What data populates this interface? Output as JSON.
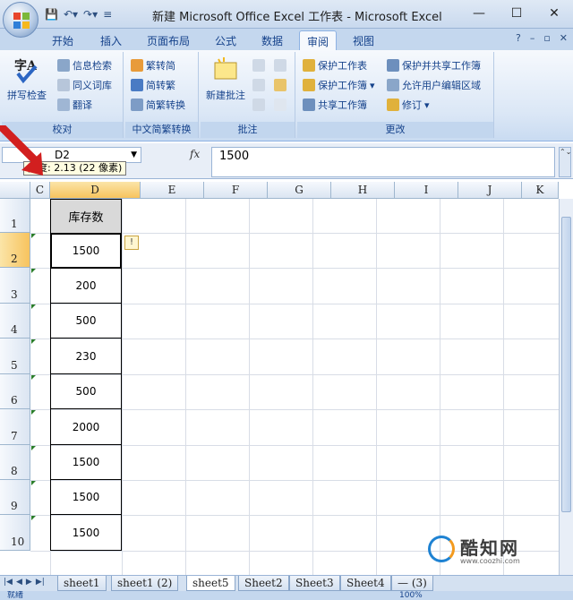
{
  "window": {
    "title": "新建 Microsoft Office Excel 工作表 - Microsoft Excel"
  },
  "ribbon_tabs": [
    "开始",
    "插入",
    "页面布局",
    "公式",
    "数据",
    "审阅",
    "视图"
  ],
  "active_tab": "审阅",
  "groups": {
    "proofing": {
      "name": "校对",
      "spell": "拼写检查",
      "research": "信息检索",
      "thesaurus": "同义词库",
      "translate": "翻译"
    },
    "chinese": {
      "name": "中文简繁转换",
      "t2s": "繁转简",
      "s2t": "简转繁",
      "convert": "简繁转换"
    },
    "comments": {
      "name": "批注",
      "new": "新建批注"
    },
    "changes": {
      "name": "更改",
      "protect_sheet": "保护工作表",
      "protect_book": "保护工作簿",
      "share_book": "共享工作簿",
      "protect_share": "保护并共享工作簿",
      "allow_edit": "允许用户编辑区域",
      "track": "修订"
    }
  },
  "formula_bar": {
    "name_box": "D2",
    "fx": "fx",
    "value": "1500",
    "tooltip": "宽度: 2.13 (22 像素)"
  },
  "columns": [
    "C",
    "D",
    "E",
    "F",
    "G",
    "H",
    "I",
    "J",
    "K"
  ],
  "rows": [
    "1",
    "2",
    "3",
    "4",
    "5",
    "6",
    "7",
    "8",
    "9",
    "10"
  ],
  "cells": {
    "header": "库存数",
    "values": [
      "1500",
      "200",
      "500",
      "230",
      "500",
      "2000",
      "1500",
      "1500",
      "1500"
    ]
  },
  "sheet_tabs": [
    "sheet1",
    "sheet1 (2)",
    "sheet5",
    "Sheet2",
    "Sheet3",
    "Sheet4",
    "— (3)"
  ],
  "active_sheet": "sheet5",
  "status": {
    "ready": "就绪",
    "zoom": "100%"
  },
  "watermark": {
    "brand": "酷知网",
    "url": "www.coozhi.com"
  }
}
